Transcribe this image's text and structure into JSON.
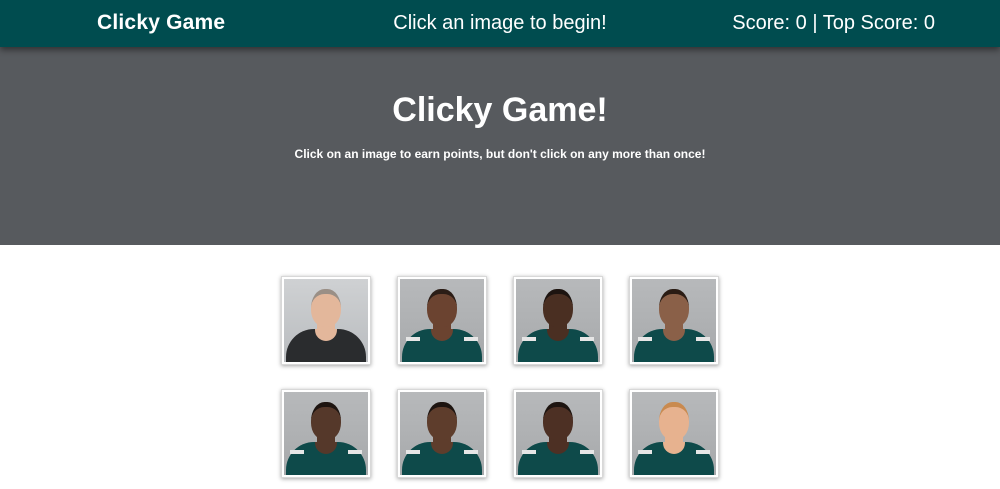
{
  "navbar": {
    "brand": "Clicky Game",
    "message": "Click an image to begin!",
    "score_text": "Score: 0 | Top Score: 0"
  },
  "hero": {
    "title": "Clicky Game!",
    "subtitle": "Click on an image to earn points, but don't click on any more than once!"
  },
  "colors": {
    "navbar_bg": "#004c4f",
    "hero_bg": "#575a5e",
    "jersey_green": "#0e4a4a"
  },
  "cards": [
    {
      "subject": "coach-portrait",
      "skin": "#e3b79b",
      "hair": "#9a8f86",
      "shirt": "dark"
    },
    {
      "subject": "player-portrait",
      "skin": "#6b4330",
      "hair": "#2b1d16",
      "shirt": "green"
    },
    {
      "subject": "player-portrait",
      "skin": "#4a2f22",
      "hair": "#1d1410",
      "shirt": "green"
    },
    {
      "subject": "player-portrait",
      "skin": "#8a6048",
      "hair": "#2a1c14",
      "shirt": "green"
    },
    {
      "subject": "player-portrait",
      "skin": "#55382a",
      "hair": "#1d1410",
      "shirt": "green"
    },
    {
      "subject": "player-portrait",
      "skin": "#5e3d2c",
      "hair": "#1d1410",
      "shirt": "green"
    },
    {
      "subject": "player-portrait",
      "skin": "#4d3024",
      "hair": "#1d1410",
      "shirt": "green"
    },
    {
      "subject": "player-portrait",
      "skin": "#e7b28f",
      "hair": "#c98a4f",
      "shirt": "green"
    }
  ]
}
